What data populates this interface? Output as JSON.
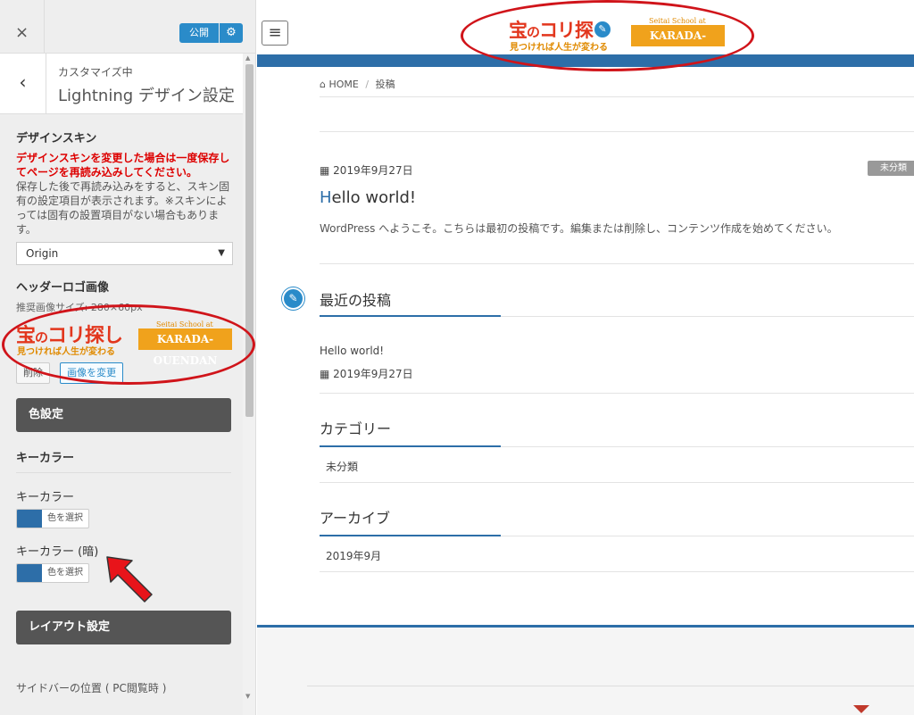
{
  "panel": {
    "close_icon": "×",
    "publish_label": "公開",
    "settings_icon": "⚙",
    "back_icon": "‹",
    "customizing_label": "カスタマイズ中",
    "section_title": "Lightning デザイン設定",
    "design_skin": {
      "title": "デザインスキン",
      "warning": "デザインスキンを変更した場合は一度保存してページを再読み込みしてください。",
      "description": "保存した後で再読み込みをすると、スキン固有の設定項目が表示されます。※スキンによっては固有の設置項目がない場合もあります。",
      "selected": "Origin"
    },
    "header_logo": {
      "title": "ヘッダーロゴ画像",
      "size_hint": "推奨画像サイズ: 280×60px",
      "remove_label": "削除",
      "change_label": "画像を変更"
    },
    "color_settings": {
      "section_label": "色設定",
      "sub_title": "キーカラー",
      "key_color_label": "キーカラー",
      "key_color_dark_label": "キーカラー (暗)",
      "select_color_label": "色を選択",
      "key_color": "#2d6ea8"
    },
    "layout_settings": {
      "section_label": "レイアウト設定",
      "sidebar_position_label": "サイドバーの位置 ( PC閲覧時 )"
    }
  },
  "logo": {
    "main_1": "宝",
    "main_no": "の",
    "main_2": "コリ探し",
    "tagline": "見つければ人生が変わる",
    "school_small": "Seitai School at",
    "brand": "KARADA-OUENDAN"
  },
  "preview": {
    "menu_icon": "≡",
    "pencil_icon": "✎",
    "breadcrumb": {
      "home_icon": "⌂",
      "home": "HOME",
      "separator": "/",
      "current": "投稿"
    },
    "post": {
      "date_icon": "▦",
      "date": "2019年9月27日",
      "category": "未分類",
      "title_first": "H",
      "title_rest": "ello world!",
      "excerpt": "WordPress へようこそ。こちらは最初の投稿です。編集または削除し、コンテンツ作成を始めてください。"
    },
    "widgets": {
      "recent_title": "最近の投稿",
      "recent_post_title": "Hello world!",
      "recent_post_date": "2019年9月27日",
      "category_title": "カテゴリー",
      "category_item": "未分類",
      "archive_title": "アーカイブ",
      "archive_item": "2019年9月"
    }
  },
  "colors": {
    "accent": "#2d6ea8",
    "publish": "#2a8bc9",
    "annotation": "#d0141a"
  }
}
